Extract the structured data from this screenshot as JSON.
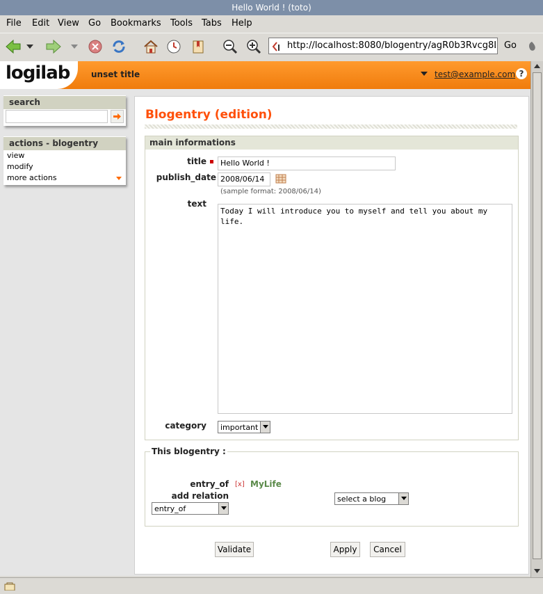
{
  "window": {
    "title": "Hello World ! (toto)"
  },
  "menubar": {
    "items": [
      "File",
      "Edit",
      "View",
      "Go",
      "Bookmarks",
      "Tools",
      "Tabs",
      "Help"
    ]
  },
  "toolbar": {
    "url": "http://localhost:8080/blogentry/agR0b3Rvcg8LEg",
    "go_label": "Go",
    "icons": [
      "back-icon",
      "forward-icon",
      "stop-icon",
      "reload-icon",
      "home-icon",
      "history-icon",
      "bookmarks-icon",
      "zoom-out-icon",
      "zoom-in-icon"
    ]
  },
  "header": {
    "logo": "logilab",
    "page_title": "unset title",
    "user": "test@example.com",
    "help": "?"
  },
  "sidebar": {
    "search": {
      "title": "search",
      "value": ""
    },
    "actions": {
      "title": "actions - blogentry",
      "items": [
        "view",
        "modify",
        "more actions"
      ]
    }
  },
  "main": {
    "heading": "Blogentry (edition)",
    "section_title": "main informations",
    "fields": {
      "title_label": "title",
      "title_value": "Hello World !",
      "publish_date_label": "publish_date",
      "publish_date_value": "2008/06/14",
      "publish_date_hint": "(sample format: 2008/06/14)",
      "text_label": "text",
      "text_value": "Today I will introduce you to myself and tell you about my life.",
      "category_label": "category",
      "category_value": "important"
    },
    "relations": {
      "title": "This blogentry :",
      "entry_of_label": "entry_of",
      "remove_marker": "[x]",
      "entry_of_value": "MyLife",
      "add_relation_label": "add relation",
      "relation_select": "entry_of",
      "target_select": "select a blog"
    },
    "buttons": {
      "validate": "Validate",
      "apply": "Apply",
      "cancel": "Cancel"
    }
  },
  "colors": {
    "accent": "#ff500a",
    "header": "#f28a1c",
    "required": "#cc0000"
  }
}
